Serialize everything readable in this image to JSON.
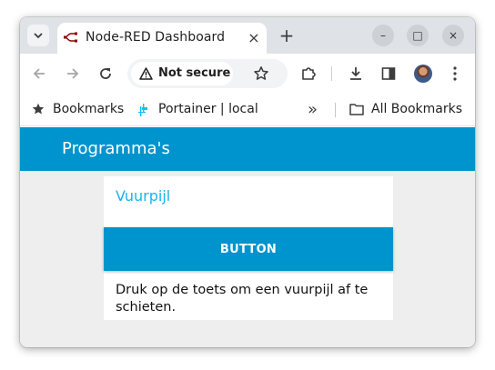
{
  "browser": {
    "tab": {
      "title": "Node-RED Dashboard",
      "close_glyph": "×"
    },
    "new_tab_glyph": "+",
    "window_controls": {
      "minimize": "–",
      "maximize": "□",
      "close": "×"
    },
    "address_bar": {
      "security_label": "Not secure"
    },
    "bookmarks_bar": {
      "items": [
        {
          "label": "Bookmarks",
          "icon": "star-icon"
        },
        {
          "label": "Portainer | local",
          "icon": "portainer-icon"
        }
      ],
      "overflow_glyph": "»",
      "all_bookmarks_label": "All Bookmarks"
    }
  },
  "dashboard": {
    "header_title": "Programma's",
    "header_color": "#0094ce",
    "card": {
      "title": "Vuurpijl",
      "button_label": "BUTTON",
      "description": "Druk op de toets om een vuurpijl af te schieten."
    },
    "accent_color": "#1bb4ef"
  }
}
